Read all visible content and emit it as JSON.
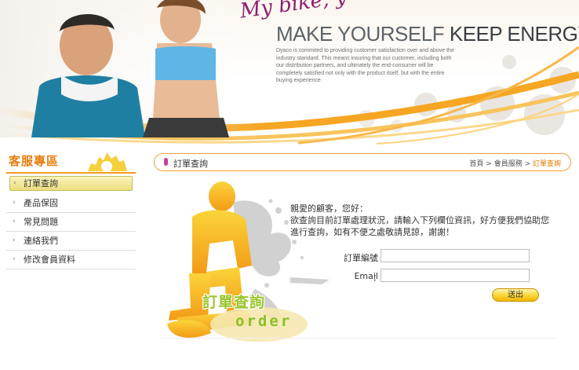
{
  "banner": {
    "tagline": "My bike, y",
    "headline_light": "MAKE YOURSELF ",
    "headline_dark": "KEEP ENERGY",
    "blurb": "Dyaco is commited to providing customer satisfaction over and above the industry standard. This means insuring that our customer, including both our distribution partners, and ultimately the end-consumer will be completely satisfied not only with the product itself, but with the entire buying experience."
  },
  "sidebar": {
    "title": "客服專區",
    "items": [
      {
        "label": "訂單查詢",
        "active": true
      },
      {
        "label": "產品保固",
        "active": false
      },
      {
        "label": "常見問題",
        "active": false
      },
      {
        "label": "連絡我們",
        "active": false
      },
      {
        "label": "修改會員資料",
        "active": false
      }
    ]
  },
  "main": {
    "title": "訂單查詢",
    "breadcrumb": {
      "home": "首頁",
      "sep": " > ",
      "member": "會員服務",
      "current": "訂單查詢"
    },
    "greeting": {
      "line1": "親愛的顧客，您好：",
      "line2": "欲查詢目前訂單處理狀況，請輸入下列欄位資訊，好方便我們協助您",
      "line3": "進行查詢，如有不便之處敬請見諒，謝謝！"
    },
    "form": {
      "order_label": "訂單編號",
      "email_label": "Email",
      "colon": "：",
      "order_value": "",
      "email_value": "",
      "submit_label": "送出"
    },
    "figure": {
      "title": "訂單查詢",
      "subtitle": "order"
    }
  },
  "colors": {
    "accent_orange": "#ea7d0c",
    "swoosh_orange": "#f29a1f",
    "green": "#9ac62a",
    "magenta": "#8d1e71"
  }
}
